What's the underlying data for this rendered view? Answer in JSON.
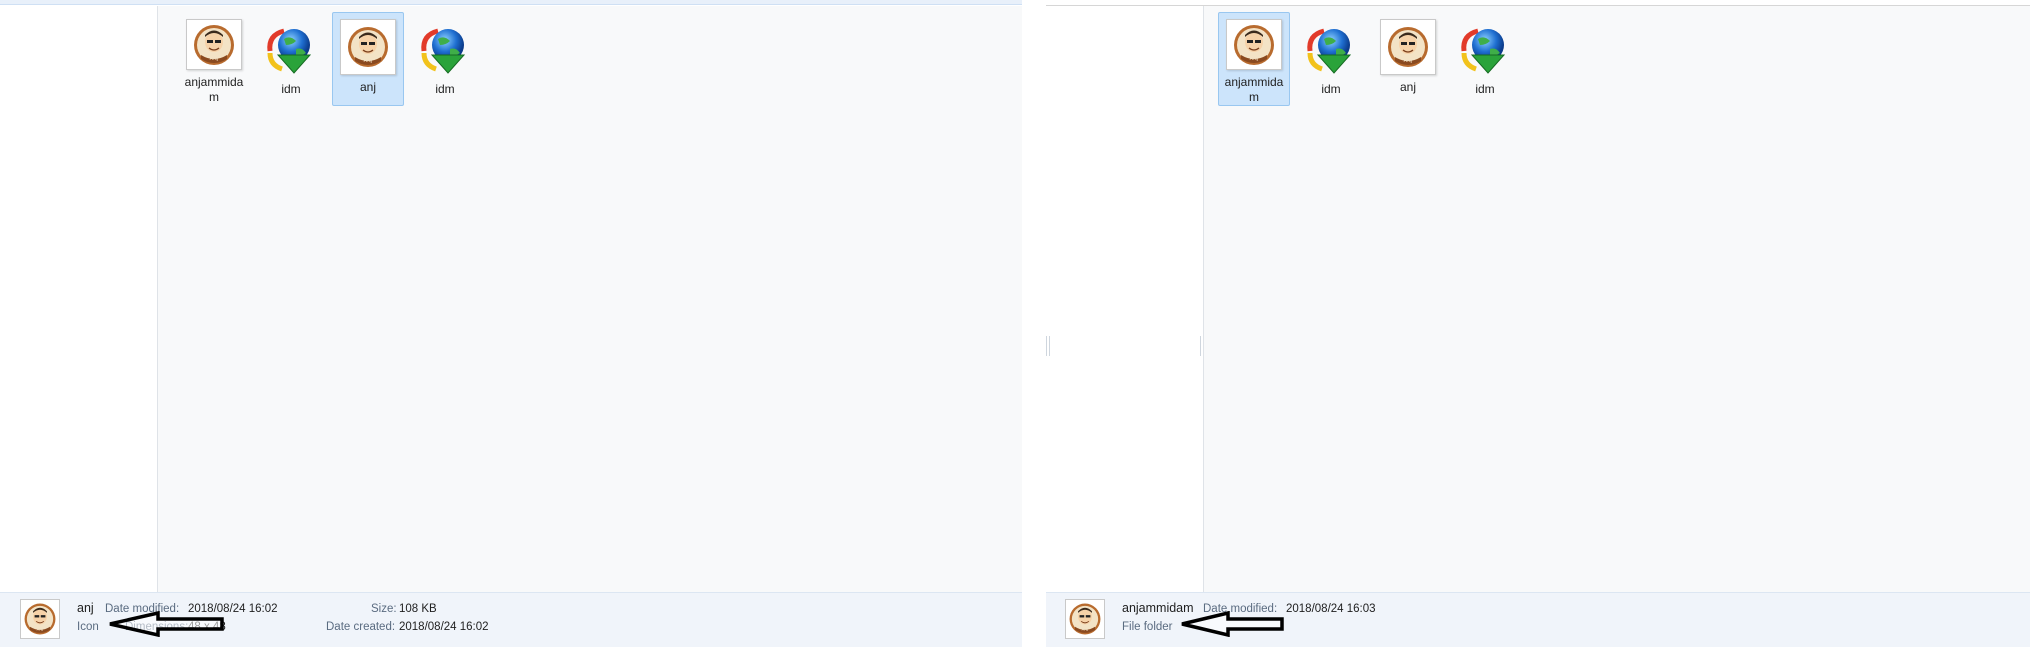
{
  "left_window": {
    "files": [
      {
        "name": "anjammidam",
        "icon": "portrait-icon",
        "selected": false
      },
      {
        "name": "idm",
        "icon": "idm-globe-icon",
        "selected": false
      },
      {
        "name": "anj",
        "icon": "portrait-icon",
        "selected": true
      },
      {
        "name": "idm",
        "icon": "idm-globe-icon",
        "selected": false
      }
    ],
    "details": {
      "name": "anj",
      "type": "Icon",
      "date_modified_label": "Date modified:",
      "date_modified": "2018/08/24 16:02",
      "dimensions_label": "Dimensions:",
      "dimensions": "48 x 48",
      "size_label": "Size:",
      "size": "108 KB",
      "date_created_label": "Date created:",
      "date_created": "2018/08/24 16:02"
    }
  },
  "right_window": {
    "files": [
      {
        "name": "anjammidam",
        "icon": "portrait-icon",
        "selected": true
      },
      {
        "name": "idm",
        "icon": "idm-globe-icon",
        "selected": false
      },
      {
        "name": "anj",
        "icon": "portrait-icon",
        "selected": false
      },
      {
        "name": "idm",
        "icon": "idm-globe-icon",
        "selected": false
      }
    ],
    "details": {
      "name": "anjammidam",
      "type": "File folder",
      "date_modified_label": "Date modified:",
      "date_modified": "2018/08/24 16:03"
    }
  },
  "colors": {
    "selection_fill": "#cce4fb",
    "selection_border": "#99c7f0",
    "details_bg": "#f0f4fa",
    "content_bg": "#f8f9fa"
  }
}
